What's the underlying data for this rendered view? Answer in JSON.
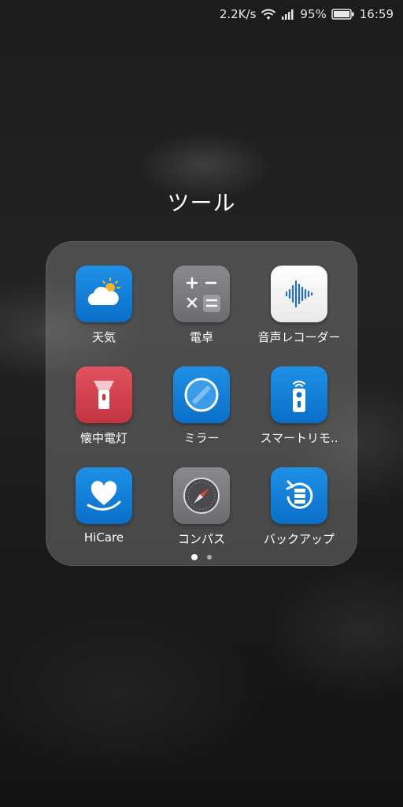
{
  "status_bar": {
    "network_speed": "2.2K/s",
    "battery_percent": "95%",
    "time": "16:59",
    "icons": [
      "wifi-icon",
      "signal-icon",
      "battery-icon"
    ]
  },
  "folder": {
    "title": "ツール",
    "apps": [
      {
        "label": "天気",
        "icon": "weather-icon"
      },
      {
        "label": "電卓",
        "icon": "calculator-icon"
      },
      {
        "label": "音声レコーダー",
        "icon": "voice-recorder-icon"
      },
      {
        "label": "懐中電灯",
        "icon": "flashlight-icon"
      },
      {
        "label": "ミラー",
        "icon": "mirror-icon"
      },
      {
        "label": "スマートリモ..",
        "icon": "smart-remote-icon"
      },
      {
        "label": "HiCare",
        "icon": "hicare-icon"
      },
      {
        "label": "コンパス",
        "icon": "compass-icon"
      },
      {
        "label": "バックアップ",
        "icon": "backup-icon"
      }
    ],
    "page_count": 2,
    "current_page": 1
  },
  "colors": {
    "blue_icon": "#0a6fc9",
    "grey_icon": "#6c6c70",
    "red_icon": "#c23440",
    "white_icon": "#ffffff"
  }
}
